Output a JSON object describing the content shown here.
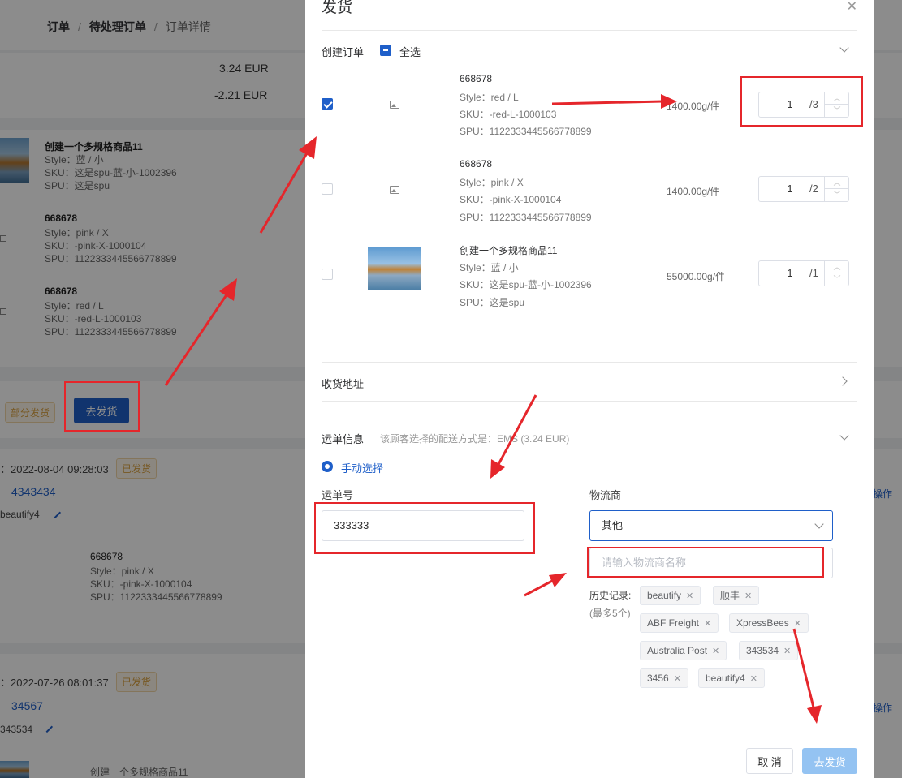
{
  "breadcrumb": [
    "订单",
    "待处理订单",
    "订单详情"
  ],
  "background": {
    "amounts": [
      "3.24 EUR",
      "-2.21 EUR"
    ],
    "items": [
      {
        "name": "创建一个多规格商品11",
        "style": "Style：蓝 / 小",
        "sku": "SKU：这是spu-蓝-小-1002396",
        "spu": "SPU：这是spu"
      },
      {
        "name": "668678",
        "style": "Style：pink / X",
        "sku": "SKU：-pink-X-1000104",
        "spu": "SPU：1122333445566778899"
      },
      {
        "name": "668678",
        "style": "Style：red / L",
        "sku": "SKU：-red-L-1000103",
        "spu": "SPU：1122333445566778899"
      }
    ],
    "partial_tag": "部分发货",
    "ship_button": "去发货",
    "shipments": [
      {
        "date": "：2022-08-04 09:28:03",
        "status": "已发货",
        "tracking": "4343434",
        "carrier": "beautify4",
        "ops": "操作",
        "item": {
          "name": "668678",
          "style": "Style：pink / X",
          "sku": "SKU：-pink-X-1000104",
          "spu": "SPU：1122333445566778899"
        }
      },
      {
        "date": "：2022-07-26 08:01:37",
        "status": "已发货",
        "tracking": "34567",
        "carrier": "343534",
        "ops": "操作",
        "item": {
          "name": "创建一个多规格商品11"
        }
      }
    ]
  },
  "drawer": {
    "title": "发货",
    "create_order": {
      "label": "创建订单",
      "select_all": "全选",
      "products": [
        {
          "checked": true,
          "image": "placeholder",
          "name": "668678",
          "style": "Style：red / L",
          "sku": "SKU：-red-L-1000103",
          "spu": "SPU：1122333445566778899",
          "weight": "1400.00g/件",
          "qty": "1",
          "max": "/3"
        },
        {
          "checked": false,
          "image": "placeholder",
          "name": "668678",
          "style": "Style：pink / X",
          "sku": "SKU：-pink-X-1000104",
          "spu": "SPU：1122333445566778899",
          "weight": "1400.00g/件",
          "qty": "1",
          "max": "/2"
        },
        {
          "checked": false,
          "image": "photo",
          "name": "创建一个多规格商品11",
          "style": "Style：蓝 / 小",
          "sku": "SKU：这是spu-蓝-小-1002396",
          "spu": "SPU：这是spu",
          "weight": "55000.00g/件",
          "qty": "1",
          "max": "/1"
        }
      ]
    },
    "address": {
      "label": "收货地址"
    },
    "waybill": {
      "label": "运单信息",
      "hint": "该顾客选择的配送方式是：",
      "hint_value": "EMS (3.24 EUR)",
      "manual_option": "手动选择",
      "tracking_label": "运单号",
      "tracking_value": "333333",
      "carrier_label": "物流商",
      "carrier_value": "其他",
      "carrier_name_placeholder": "请输入物流商名称",
      "history_label": "历史记录:",
      "history_note": "(最多5个)",
      "history": [
        "beautify",
        "顺丰",
        "ABF Freight",
        "XpressBees",
        "Australia Post",
        "343534",
        "3456",
        "beautify4"
      ]
    },
    "buttons": {
      "cancel": "取 消",
      "ship": "去发货"
    }
  },
  "colors": {
    "primary": "#1f5fc9",
    "annotation_red": "#e5262b",
    "tag_orange": "#d9a03f",
    "disabled_primary": "#94c3f2"
  }
}
